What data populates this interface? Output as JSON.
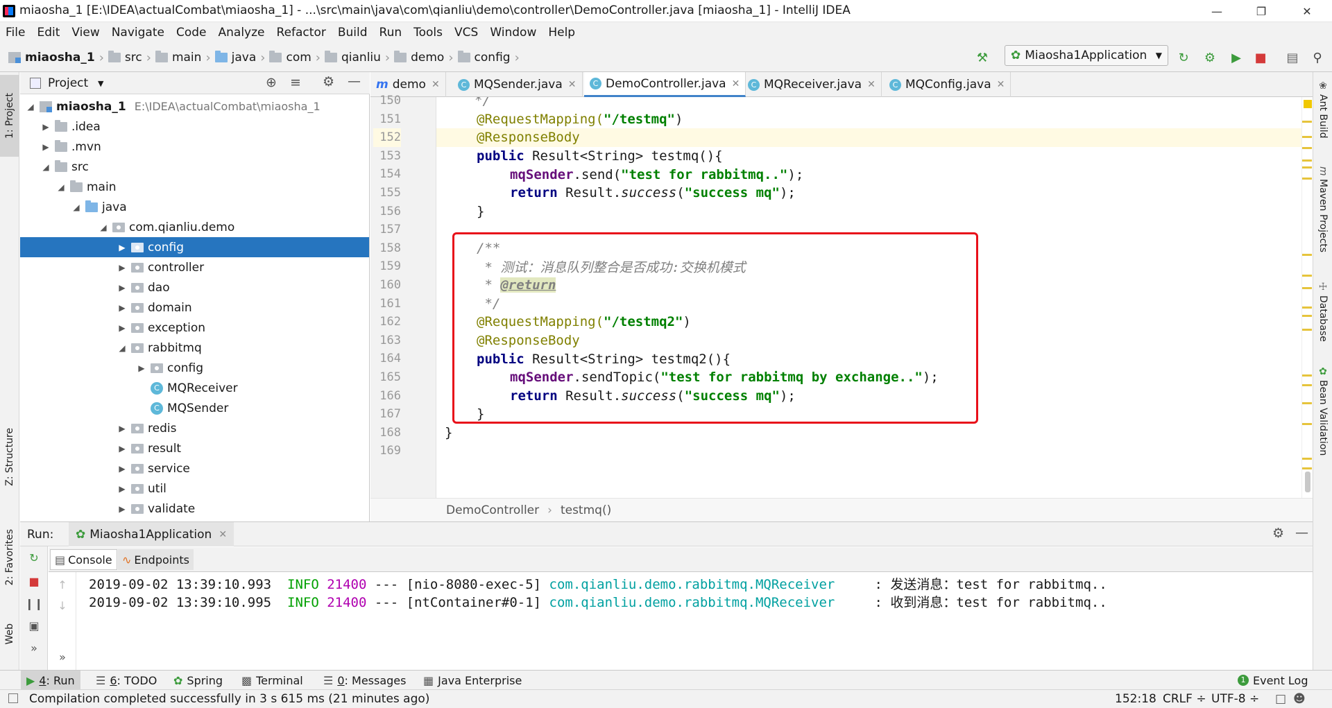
{
  "window": {
    "title": "miaosha_1 [E:\\IDEA\\actualCombat\\miaosha_1] - ...\\src\\main\\java\\com\\qianliu\\demo\\controller\\DemoController.java [miaosha_1] - IntelliJ IDEA"
  },
  "menu": [
    "File",
    "Edit",
    "View",
    "Navigate",
    "Code",
    "Analyze",
    "Refactor",
    "Build",
    "Run",
    "Tools",
    "VCS",
    "Window",
    "Help"
  ],
  "breadcrumbs": [
    "miaosha_1",
    "src",
    "main",
    "java",
    "com",
    "qianliu",
    "demo",
    "config"
  ],
  "run_config": "Miaosha1Application",
  "left_strip": {
    "project": "1: Project",
    "structure": "Z: Structure",
    "favorites": "2: Favorites",
    "web": "Web"
  },
  "right_strip": {
    "ant": "Ant Build",
    "maven": "Maven Projects",
    "database": "Database",
    "bean": "Bean Validation"
  },
  "project": {
    "header": "Project",
    "root_name": "miaosha_1",
    "root_path": "E:\\IDEA\\actualCombat\\miaosha_1",
    "items": [
      ".idea",
      ".mvn",
      "src",
      "main",
      "java",
      "com.qianliu.demo",
      "config",
      "controller",
      "dao",
      "domain",
      "exception",
      "rabbitmq",
      "config",
      "MQReceiver",
      "MQSender",
      "redis",
      "result",
      "service",
      "util",
      "validate"
    ]
  },
  "tabs": [
    "demo",
    "MQSender.java",
    "DemoController.java",
    "MQReceiver.java",
    "MQConfig.java"
  ],
  "code": {
    "line_numbers": [
      "150",
      "151",
      "152",
      "153",
      "154",
      "155",
      "156",
      "157",
      "158",
      "159",
      "160",
      "161",
      "162",
      "163",
      "164",
      "165",
      "166",
      "167",
      "168",
      "169"
    ],
    "l150": "*/",
    "l151_ann": "@RequestMapping(",
    "l151_str": "\"/testmq\"",
    "l151_end": ")",
    "l152": "@ResponseBody",
    "l153_kw": "public",
    "l153_rest": " Result<String> testmq(){",
    "l154_fld": "mqSender",
    "l154_mid": ".send(",
    "l154_str": "\"test for rabbitmq..\"",
    "l154_end": ");",
    "l155_kw": "return",
    "l155_mid": " Result.",
    "l155_it": "success",
    "l155_p": "(",
    "l155_str": "\"success mq\"",
    "l155_end": ");",
    "l156": "}",
    "l158": "/**",
    "l159": " * 测试：消息队列整合是否成功:交换机模式",
    "l160_pre": " * ",
    "l160_tag": "@return",
    "l161": " */",
    "l162_ann": "@RequestMapping(",
    "l162_str": "\"/testmq2\"",
    "l162_end": ")",
    "l163": "@ResponseBody",
    "l164_kw": "public",
    "l164_rest": " Result<String> testmq2(){",
    "l165_fld": "mqSender",
    "l165_mid": ".sendTopic(",
    "l165_str": "\"test for rabbitmq by exchange..\"",
    "l165_end": ");",
    "l166_kw": "return",
    "l166_mid": " Result.",
    "l166_it": "success",
    "l166_p": "(",
    "l166_str": "\"success mq\"",
    "l166_end": ");",
    "l167": "}",
    "l168": "}"
  },
  "editor_breadcrumb": {
    "cls": "DemoController",
    "method": "testmq()"
  },
  "run": {
    "label": "Run:",
    "tab": "Miaosha1Application",
    "console": "Console",
    "endpoints": "Endpoints",
    "logs": [
      {
        "time": "2019-09-02 13:39:10.993",
        "level": "INFO",
        "pid": "21400",
        "thread": " --- [nio-8080-exec-5] ",
        "logger": "com.qianliu.demo.rabbitmq.MQReceiver",
        "msg": "     : 发送消息：test for rabbitmq.."
      },
      {
        "time": "2019-09-02 13:39:10.995",
        "level": "INFO",
        "pid": "21400",
        "thread": " --- [ntContainer#0-1] ",
        "logger": "com.qianliu.demo.rabbitmq.MQReceiver",
        "msg": "     : 收到消息：test for rabbitmq.."
      }
    ]
  },
  "bottom_tabs": [
    {
      "mn": "4",
      "label": ": Run"
    },
    {
      "mn": "6",
      "label": ": TODO"
    },
    {
      "mn": "",
      "label": "Spring"
    },
    {
      "mn": "",
      "label": "Terminal"
    },
    {
      "mn": "0",
      "label": ": Messages"
    },
    {
      "mn": "",
      "label": "Java Enterprise"
    }
  ],
  "event_log": "Event Log",
  "status": {
    "message": "Compilation completed successfully in 3 s 615 ms (21 minutes ago)",
    "position": "152:18",
    "line_sep": "CRLF ÷",
    "encoding": "UTF-8 ÷"
  }
}
